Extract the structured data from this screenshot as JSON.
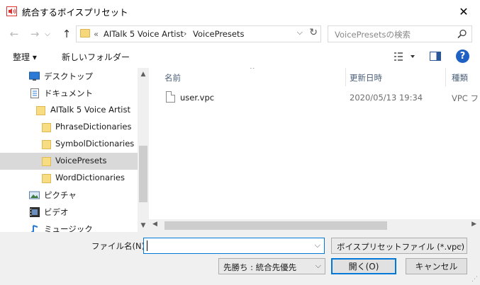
{
  "window": {
    "title": "統合するボイスプリセット",
    "close_glyph": "✕"
  },
  "address": {
    "prefix": "«",
    "crumbs": [
      "AITalk 5 Voice Artist",
      "VoicePresets"
    ],
    "separator": "›",
    "dropdown_glyph": "⌵",
    "refresh_glyph": "↻",
    "search_placeholder": "VoicePresetsの検索",
    "back_glyph": "←",
    "forward_glyph": "→",
    "history_glyph": "⌵",
    "up_glyph": "↑"
  },
  "toolbar": {
    "organize_label": "整理 ▾",
    "new_folder_label": "新しいフォルダー",
    "help_label": "?"
  },
  "nav": {
    "items": [
      {
        "label": "デスクトップ",
        "icon": "desktop-icon"
      },
      {
        "label": "ドキュメント",
        "icon": "documents-icon"
      },
      {
        "label": "AITalk 5 Voice Artist",
        "icon": "folder-icon"
      },
      {
        "label": "PhraseDictionaries",
        "icon": "folder-icon"
      },
      {
        "label": "SymbolDictionaries",
        "icon": "folder-icon"
      },
      {
        "label": "VoicePresets",
        "icon": "folder-icon",
        "selected": true
      },
      {
        "label": "WordDictionaries",
        "icon": "folder-icon"
      },
      {
        "label": "ピクチャ",
        "icon": "pictures-icon"
      },
      {
        "label": "ビデオ",
        "icon": "videos-icon"
      },
      {
        "label": "ミュージック",
        "icon": "music-icon"
      }
    ]
  },
  "columns": {
    "name": "名前",
    "date": "更新日時",
    "type": "種類",
    "sort_glyph": "^"
  },
  "files": [
    {
      "name": "user.vpc",
      "date": "2020/05/13 19:34",
      "type": "VPC ファ"
    }
  ],
  "bottom": {
    "filename_label": "ファイル名(N):",
    "filename_value": "",
    "dropdown_glyph": "⌵",
    "filter_value": "ボイスプリセットファイル (*.vpc)",
    "priority_value": "先勝ち : 統合先優先",
    "open_label": "開く(O)",
    "cancel_label": "キャンセル"
  },
  "colors": {
    "accent": "#0078d7",
    "folder": "#f8dc82",
    "selection": "#d9d9d9"
  }
}
